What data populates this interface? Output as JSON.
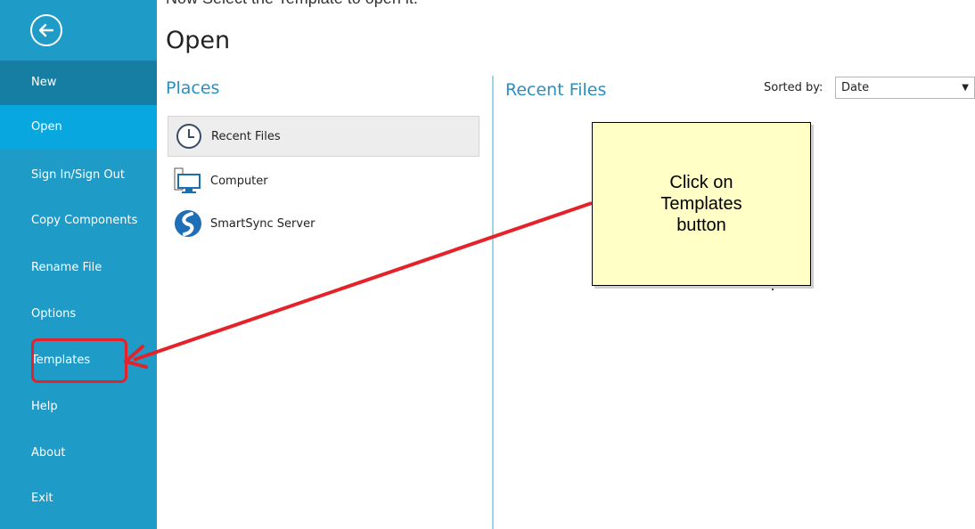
{
  "caption_top": "Now Select the Template to open it.",
  "sidebar": {
    "items": [
      {
        "label": "New"
      },
      {
        "label": "Open"
      },
      {
        "label": "Sign In/Sign Out"
      },
      {
        "label": "Copy Components"
      },
      {
        "label": "Rename File"
      },
      {
        "label": "Options"
      },
      {
        "label": "Templates"
      },
      {
        "label": "Help"
      },
      {
        "label": "About"
      },
      {
        "label": "Exit"
      }
    ],
    "active": "Open",
    "colors": {
      "background": "#1f9bc7",
      "new_item": "#177ea3",
      "active_item": "#08a7e0"
    }
  },
  "main": {
    "title": "Open",
    "places_title": "Places",
    "places": [
      {
        "label": "Recent Files",
        "icon": "clock-icon"
      },
      {
        "label": "Computer",
        "icon": "computer-icon"
      },
      {
        "label": "SmartSync Server",
        "icon": "smartsync-icon"
      }
    ],
    "recent_title": "Recent Files",
    "sorted_label": "Sorted by:",
    "sort_value": "Date"
  },
  "annotation": {
    "callout_text": "Click on\nTemplates\nbutton",
    "highlight_color": "#e3222a"
  }
}
